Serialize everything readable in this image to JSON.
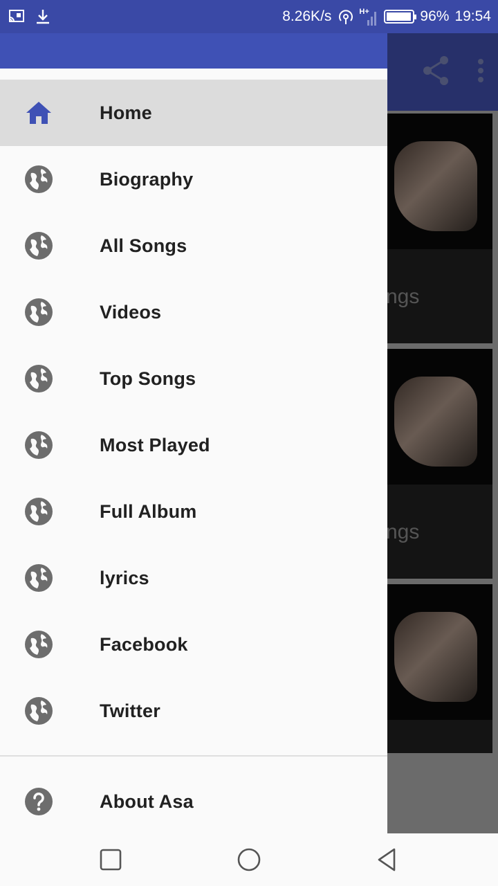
{
  "status_bar": {
    "network_speed": "8.26K/s",
    "network_type": "H+",
    "battery_percent": "96%",
    "battery_level": 0.96,
    "time": "19:54",
    "icons": [
      "screen-cast-icon",
      "download-icon",
      "hotspot-icon",
      "signal-icon",
      "battery-icon"
    ]
  },
  "toolbar": {
    "actions": [
      "share-icon",
      "overflow-menu-icon"
    ]
  },
  "background_cards": [
    {
      "label": "ngs"
    },
    {
      "label": "ngs"
    },
    {
      "label": ""
    }
  ],
  "drawer": {
    "accent_color": "#3f51b5",
    "items": [
      {
        "label": "Home",
        "icon": "home-icon",
        "active": true
      },
      {
        "label": "Biography",
        "icon": "globe-icon"
      },
      {
        "label": "All Songs",
        "icon": "globe-icon"
      },
      {
        "label": "Videos",
        "icon": "globe-icon"
      },
      {
        "label": "Top Songs",
        "icon": "globe-icon"
      },
      {
        "label": "Most Played",
        "icon": "globe-icon"
      },
      {
        "label": "Full Album",
        "icon": "globe-icon"
      },
      {
        "label": "lyrics",
        "icon": "globe-icon"
      },
      {
        "label": "Facebook",
        "icon": "globe-icon"
      },
      {
        "label": "Twitter",
        "icon": "globe-icon"
      }
    ],
    "footer_item": {
      "label": "About Asa",
      "icon": "help-icon"
    }
  },
  "nav_bar": {
    "buttons": [
      "recents-button",
      "home-button",
      "back-button"
    ]
  }
}
